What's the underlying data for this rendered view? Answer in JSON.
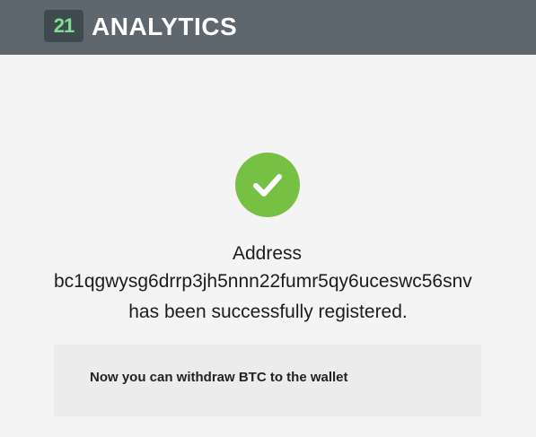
{
  "header": {
    "logo_badge": "21",
    "brand": "ANALYTICS",
    "background_color": "#5f676e",
    "logo_color": "#7ee08f"
  },
  "status": {
    "icon": "checkmark-icon",
    "color": "#76c043"
  },
  "message": {
    "line1": "Address",
    "address": "bc1qgwysg6drrp3jh5nnn22fumr5qy6uceswc56snv",
    "line3": "has been successfully registered."
  },
  "notice": {
    "text": "Now you can withdraw BTC to the wallet"
  }
}
